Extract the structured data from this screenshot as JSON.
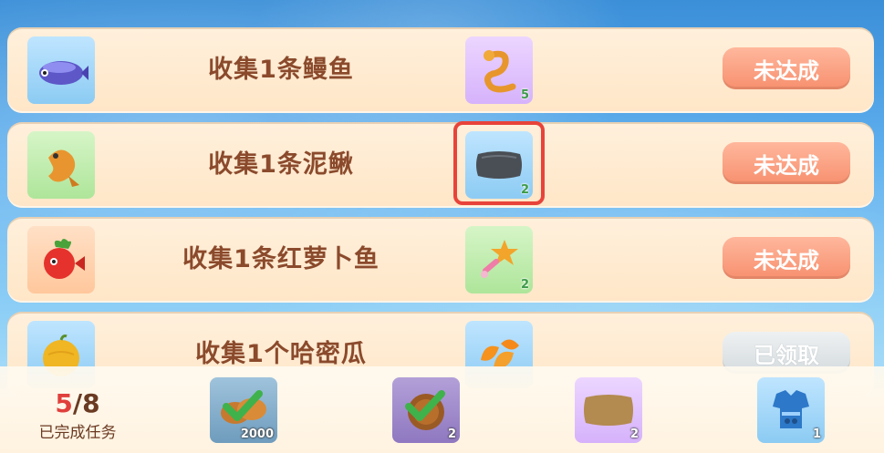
{
  "tasks": [
    {
      "title": "收集1条鳗鱼",
      "reward_count": "5",
      "button": "未达成",
      "fish_icon": "eel-fish-icon",
      "reward_icon": "golden-snake-icon",
      "state": "not-achieved"
    },
    {
      "title": "收集1条泥鳅",
      "reward_count": "2",
      "button": "未达成",
      "fish_icon": "loach-fish-icon",
      "reward_icon": "dark-pillow-icon",
      "state": "not-achieved"
    },
    {
      "title": "收集1条红萝卜鱼",
      "reward_count": "2",
      "button": "未达成",
      "fish_icon": "carrot-fish-icon",
      "reward_icon": "star-wand-icon",
      "state": "not-achieved"
    },
    {
      "title": "收集1个哈密瓜",
      "reward_count": "",
      "button": "已领取",
      "fish_icon": "cantaloupe-icon",
      "reward_icon": "orange-slices-icon",
      "state": "claimed"
    }
  ],
  "progress": {
    "done": "5",
    "separator": "/",
    "total": "8",
    "label": "已完成任务"
  },
  "rewards": [
    {
      "count": "2000",
      "icon": "bread-icon",
      "claimed": true
    },
    {
      "count": "2",
      "icon": "nut-bowl-icon",
      "claimed": true
    },
    {
      "count": "2",
      "icon": "brown-pillow-icon",
      "claimed": false
    },
    {
      "count": "1",
      "icon": "blue-outfit-icon",
      "claimed": false
    }
  ],
  "colors": {
    "highlight": "#e8433a",
    "button": "#f7906f",
    "title": "#8b4a2c",
    "progress_done": "#e0403c"
  }
}
